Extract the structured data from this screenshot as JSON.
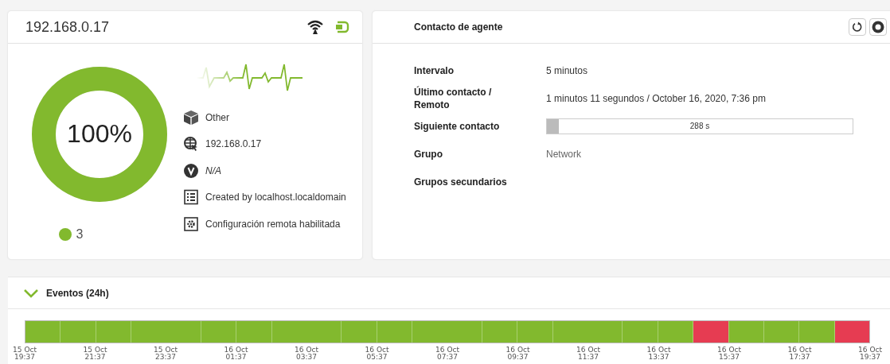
{
  "agent": {
    "title": "192.168.0.17",
    "percent": "100%",
    "level": 1,
    "legend": {
      "color": "#82b92e",
      "count": "3"
    },
    "details": [
      {
        "kind": "os",
        "text": "Other"
      },
      {
        "kind": "address",
        "text": "192.168.0.17"
      },
      {
        "kind": "version",
        "text": "N/A"
      },
      {
        "kind": "creator",
        "text": "Created by localhost.localdomain"
      },
      {
        "kind": "remote",
        "text": "Configuración remota habilitada"
      }
    ]
  },
  "contact": {
    "title": "Contacto de agente",
    "rows": [
      {
        "kind": "text",
        "label": "Intervalo",
        "value": "5 minutos"
      },
      {
        "kind": "text",
        "label": "Último contacto / Remoto",
        "value": "1 minutos 11 segundos / October 16, 2020, 7:36 pm"
      },
      {
        "kind": "progress",
        "label": "Siguiente contacto",
        "value": "288 s",
        "level": 0.04
      },
      {
        "kind": "muted",
        "label": "Grupo",
        "value": "Network"
      },
      {
        "kind": "text",
        "label": "Grupos secundarios"
      }
    ]
  },
  "events": {
    "title": "Eventos (24h)",
    "expanded": true,
    "segments": [
      {
        "color": "#82b92e",
        "wide": false
      },
      {
        "color": "#82b92e",
        "wide": false
      },
      {
        "color": "#82b92e",
        "wide": false
      },
      {
        "color": "#82b92e",
        "wide": true
      },
      {
        "color": "#82b92e",
        "wide": false
      },
      {
        "color": "#82b92e",
        "wide": false
      },
      {
        "color": "#82b92e",
        "wide": true
      },
      {
        "color": "#82b92e",
        "wide": false
      },
      {
        "color": "#82b92e",
        "wide": false
      },
      {
        "color": "#82b92e",
        "wide": true
      },
      {
        "color": "#82b92e",
        "wide": false
      },
      {
        "color": "#82b92e",
        "wide": false
      },
      {
        "color": "#82b92e",
        "wide": true
      },
      {
        "color": "#82b92e",
        "wide": false
      },
      {
        "color": "#82b92e",
        "wide": false
      },
      {
        "color": "#e63c52",
        "wide": false
      },
      {
        "color": "#82b92e",
        "wide": false
      },
      {
        "color": "#82b92e",
        "wide": false
      },
      {
        "color": "#82b92e",
        "wide": false
      },
      {
        "color": "#e63c52",
        "wide": false
      }
    ],
    "ticks": [
      {
        "date": "15 Oct",
        "time": "19:37"
      },
      {
        "date": "15 Oct",
        "time": "21:37"
      },
      {
        "date": "15 Oct",
        "time": "23:37"
      },
      {
        "date": "16 Oct",
        "time": "01:37"
      },
      {
        "date": "16 Oct",
        "time": "03:37"
      },
      {
        "date": "16 Oct",
        "time": "05:37"
      },
      {
        "date": "16 Oct",
        "time": "07:37"
      },
      {
        "date": "16 Oct",
        "time": "09:37"
      },
      {
        "date": "16 Oct",
        "time": "11:37"
      },
      {
        "date": "16 Oct",
        "time": "13:37"
      },
      {
        "date": "16 Oct",
        "time": "15:37"
      },
      {
        "date": "16 Oct",
        "time": "17:37"
      },
      {
        "date": "16 Oct",
        "time": "19:37"
      }
    ]
  }
}
